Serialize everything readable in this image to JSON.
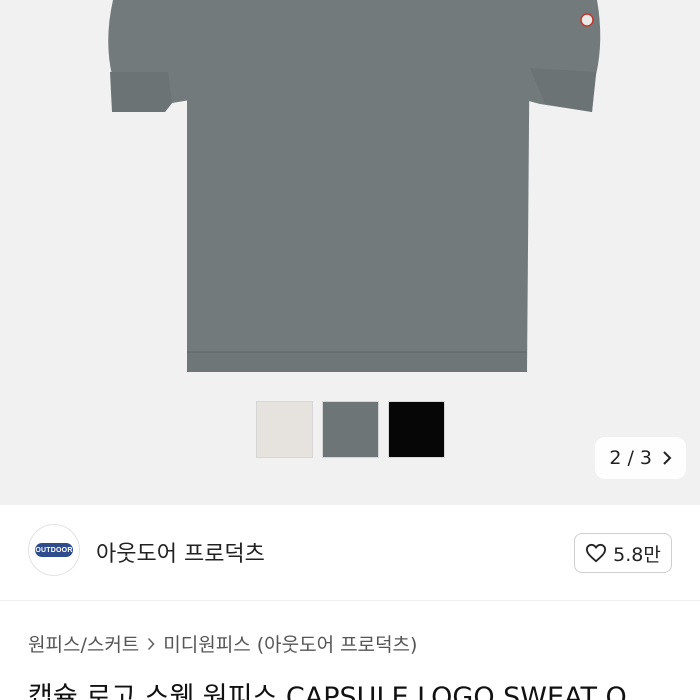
{
  "gallery": {
    "pager_current": "2",
    "pager_separator": "/",
    "pager_total": "3",
    "swatch_colors": [
      "#e6e3de",
      "#6e7577",
      "#060606"
    ],
    "product_color": "#737a7c"
  },
  "seller": {
    "logo_text": "OUTDOOR",
    "name": "아웃도어 프로덕츠",
    "like_count": "5.8만"
  },
  "breadcrumb": {
    "items": [
      "원피스/스커트",
      "미디원피스 (아웃도어 프로덕츠)"
    ]
  },
  "product": {
    "title": "캡슐 로고 스웻 원피스 CAPSULE LOGO SWEAT O"
  }
}
